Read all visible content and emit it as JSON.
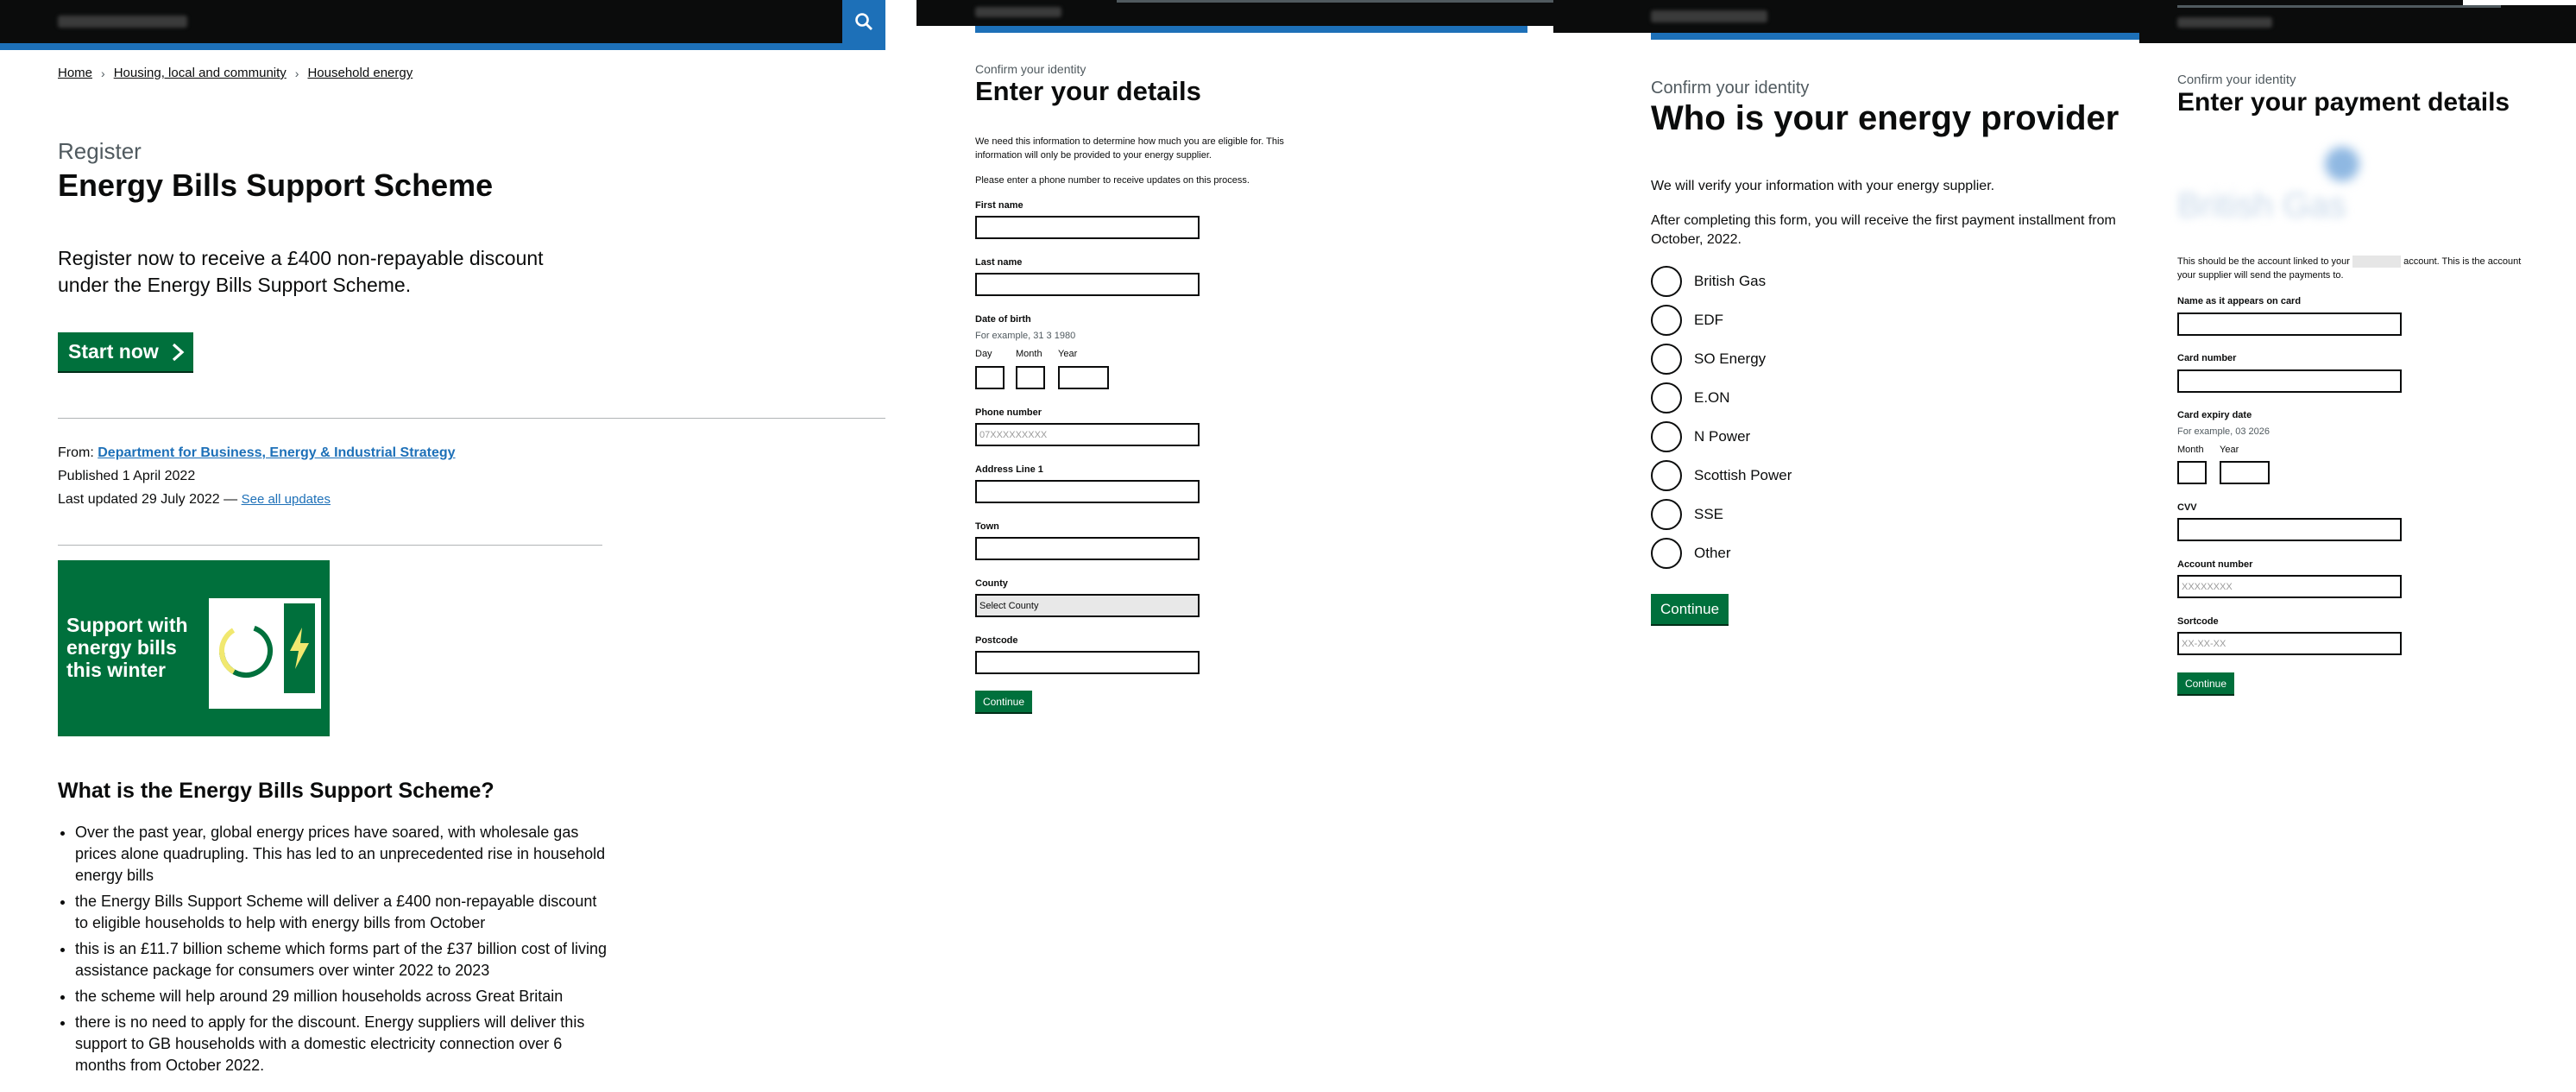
{
  "panel1": {
    "header": {
      "search_icon": "search-icon"
    },
    "breadcrumb": [
      "Home",
      "Housing, local and community",
      "Household energy"
    ],
    "caption": "Register",
    "title": "Energy Bills Support Scheme",
    "lead": "Register now to receive a £400 non-repayable discount under the Energy Bills Support Scheme.",
    "start_button": "Start now",
    "meta": {
      "from_label": "From:",
      "from_link": "Department for Business, Energy & Industrial Strategy",
      "published": "Published 1 April 2022",
      "updated": "Last updated 29 July 2022 —",
      "see_all": "See all updates"
    },
    "banner_text": "Support with energy bills this winter",
    "section_heading": "What is the Energy Bills Support Scheme?",
    "bullets": [
      "Over the past year, global energy prices have soared, with wholesale gas prices alone quadrupling. This has led to an unprecedented rise in household energy bills",
      "the Energy Bills Support Scheme will deliver a £400 non-repayable discount to eligible households to help with energy bills from October",
      "this is an £11.7 billion scheme which forms part of the £37 billion cost of living assistance package for consumers over winter 2022 to 2023",
      "the scheme will help around 29 million households across Great Britain",
      "there is no need to apply for the discount. Energy suppliers will deliver this support to GB households with a domestic electricity connection over 6 months from October 2022."
    ]
  },
  "panel2": {
    "caption": "Confirm your identity",
    "title": "Enter your details",
    "intro1": "We need this information to determine how much you are eligible for. This information will only be provided to your energy supplier.",
    "intro2": "Please enter a phone number to receive updates on this process.",
    "first_name": "First name",
    "last_name": "Last name",
    "dob": "Date of birth",
    "dob_hint": "For example, 31 3 1980",
    "day": "Day",
    "month": "Month",
    "year": "Year",
    "phone": "Phone number",
    "phone_placeholder": "07XXXXXXXXX",
    "address": "Address Line 1",
    "town": "Town",
    "county": "County",
    "county_value": "Select County",
    "postcode": "Postcode",
    "continue": "Continue"
  },
  "panel3": {
    "caption": "Confirm your identity",
    "title": "Who is your energy provider",
    "p1": "We will verify your information with your energy supplier.",
    "p2": "After completing this form, you will receive the first payment installment from October, 2022.",
    "options": [
      "British Gas",
      "EDF",
      "SO Energy",
      "E.ON",
      "N Power",
      "Scottish Power",
      "SSE",
      "Other"
    ],
    "continue": "Continue"
  },
  "panel4": {
    "caption": "Confirm your identity",
    "title": "Enter your payment details",
    "logo_text": "British Gas",
    "note_a": "This should be the account linked to your",
    "note_b": "account. This is the account your supplier will send the payments to.",
    "name_on_card": "Name as it appears on card",
    "card_number": "Card number",
    "expiry": "Card expiry date",
    "expiry_hint": "For example, 03 2026",
    "month": "Month",
    "year": "Year",
    "cvv": "CVV",
    "account_number": "Account number",
    "account_placeholder": "XXXXXXXX",
    "sortcode": "Sortcode",
    "sortcode_placeholder": "XX-XX-XX",
    "continue": "Continue"
  }
}
